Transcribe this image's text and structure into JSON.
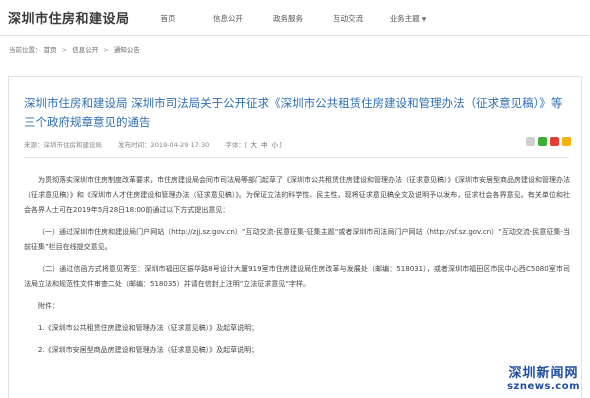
{
  "header": {
    "logo": "深圳市住房和建设局",
    "nav": [
      {
        "label": "首页",
        "has_dropdown": false
      },
      {
        "label": "信息公开",
        "has_dropdown": false
      },
      {
        "label": "政务服务",
        "has_dropdown": false
      },
      {
        "label": "互动交流",
        "has_dropdown": false
      },
      {
        "label": "业务主题",
        "has_dropdown": true
      }
    ]
  },
  "breadcrumb": {
    "prefix": "当前位置：",
    "items": [
      "首页",
      "信息公开",
      "通知公告"
    ],
    "separator": ">"
  },
  "article": {
    "title": "深圳市住房和建设局 深圳市司法局关于公开征求《深圳市公共租赁住房建设和管理办法（征求意见稿）》等三个政府规章意见的通告",
    "meta": {
      "source": "来源：深圳市住房和建设局",
      "date": "发布时间：2019-04-29 17:30",
      "font_size_label": "字体：",
      "sizes": [
        "大",
        "中",
        "小"
      ]
    },
    "paragraphs": [
      "为贯彻落实深圳市住房制度改革要求，市住房建设局会同市司法局等部门起草了《深圳市公共租赁住房建设和管理办法（征求意见稿）》《深圳市安居型商品房建设和管理办法（征求意见稿）》和《深圳市人才住房建设和管理办法（征求意见稿）》。为保证立法的科学性、民主性，现将征求意见稿全文及说明予以发布，征求社会各界意见。有关单位和社会各界人士可在2019年5月28日18:00前通过以下方式提出意见：",
      "（一）通过深圳市住房和建设局门户网站（http://zjj.sz.gov.cn）“互动交流-民意征集-征集主题”或者深圳市司法局门户网站（http://sf.sz.gov.cn）“互动交流-民意征集-当前征集”栏目在线提交意见。",
      "（二）通过信函方式将意见寄至：深圳市福田区振华路8号设计大厦919室市住房建设局住房改革与发展处（邮编：518031），或者深圳市福田区市民中心西C5080室市司法局立法和规范性文件审查二处（邮编：518035）并请在信封上注明“立法征求意见”字样。",
      "附件：",
      "1.《深圳市公共租赁住房建设和管理办法（征求意见稿）》及起草说明；",
      "2.《深圳市安居型商品房建设和管理办法（征求意见稿）》及起草说明；"
    ]
  },
  "watermark": {
    "cn": "深圳新闻网",
    "en": "sznews.com"
  },
  "colors": {
    "title": "#2f6fb4",
    "watermark": "#1e4fa0",
    "wechat": "#3cb034",
    "weibo": "#e33e33",
    "qzone": "#f5b400"
  }
}
